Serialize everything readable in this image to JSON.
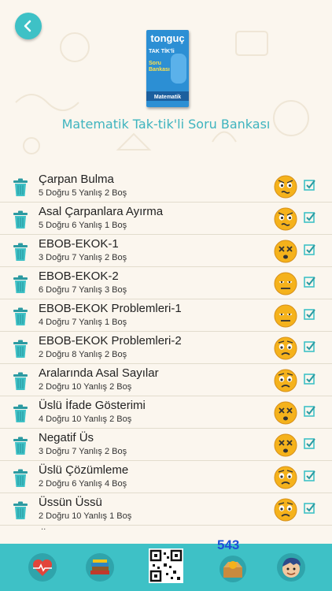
{
  "header": {
    "back_icon": "chevron-left-icon",
    "book": {
      "brand": "tonguç",
      "series": "TAK TİK'li",
      "kind": "Soru Bankası",
      "subject": "Matematik"
    },
    "title": "Matematik Tak-tik'li Soru Bankası"
  },
  "tests": [
    {
      "name": "Çarpan Bulma",
      "stats": "5 Doğru 5 Yanlış 2 Boş",
      "face": "confused"
    },
    {
      "name": "Asal Çarpanlara Ayırma",
      "stats": "5 Doğru 6 Yanlış 1 Boş",
      "face": "confused"
    },
    {
      "name": "EBOB-EKOK-1",
      "stats": "3 Doğru 7 Yanlış 2 Boş",
      "face": "dizzy"
    },
    {
      "name": "EBOB-EKOK-2",
      "stats": "6 Doğru 7 Yanlış 3 Boş",
      "face": "neutral"
    },
    {
      "name": "EBOB-EKOK Problemleri-1",
      "stats": "4 Doğru 7 Yanlış 1 Boş",
      "face": "neutral"
    },
    {
      "name": "EBOB-EKOK Problemleri-2",
      "stats": "2 Doğru 8 Yanlış 2 Boş",
      "face": "worried"
    },
    {
      "name": "Aralarında Asal Sayılar",
      "stats": "2 Doğru 10 Yanlış 2 Boş",
      "face": "worried"
    },
    {
      "name": "Üslü İfade Gösterimi",
      "stats": "4 Doğru 10 Yanlış 2 Boş",
      "face": "dizzy"
    },
    {
      "name": "Negatif Üs",
      "stats": "3 Doğru 7 Yanlış 2 Boş",
      "face": "dizzy"
    },
    {
      "name": "Üslü Çözümleme",
      "stats": "2 Doğru 6 Yanlış 4 Boş",
      "face": "worried"
    },
    {
      "name": "Üssün Üssü",
      "stats": "2 Doğru 10 Yanlış 1 Boş",
      "face": "worried"
    }
  ],
  "more_indicator": "..",
  "bottom_bar": {
    "counter": "543",
    "tabs": [
      "heart-pulse-icon",
      "books-icon",
      "qr-code-icon",
      "treasure-box-icon",
      "avatar-icon"
    ]
  },
  "colors": {
    "accent": "#3ec1c6",
    "title": "#3eb4bf",
    "face": "#f5b21b",
    "counter": "#1d4fd8"
  }
}
